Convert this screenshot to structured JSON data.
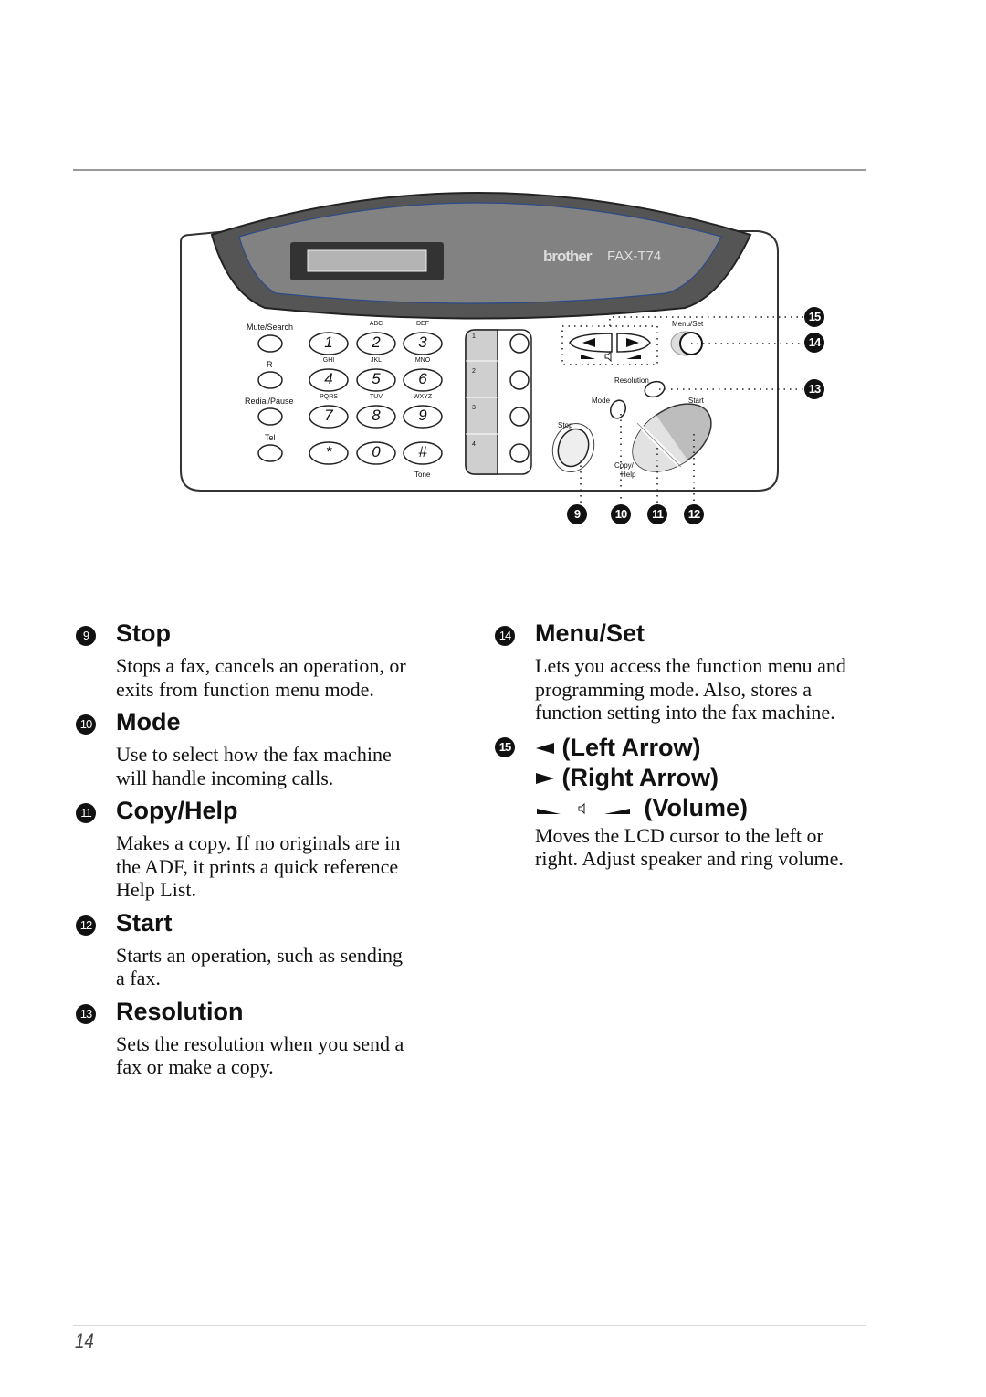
{
  "figure": {
    "brand": "brother",
    "model": "FAX-T74",
    "left_keys": [
      "Mute/Search",
      "R",
      "Redial/Pause",
      "Tel"
    ],
    "dial_keys": [
      {
        "digit": "1",
        "letters": ""
      },
      {
        "digit": "2",
        "letters": "ABC"
      },
      {
        "digit": "3",
        "letters": "DEF"
      },
      {
        "digit": "4",
        "letters": "GHI"
      },
      {
        "digit": "5",
        "letters": "JKL"
      },
      {
        "digit": "6",
        "letters": "MNO"
      },
      {
        "digit": "7",
        "letters": "PQRS"
      },
      {
        "digit": "8",
        "letters": "TUV"
      },
      {
        "digit": "9",
        "letters": "WXYZ"
      },
      {
        "digit": "*",
        "letters": ""
      },
      {
        "digit": "0",
        "letters": ""
      },
      {
        "digit": "#",
        "letters": ""
      }
    ],
    "tone_label": "Tone",
    "one_touch": [
      "1",
      "2",
      "3",
      "4"
    ],
    "labels": {
      "menu_set": "Menu/Set",
      "resolution": "Resolution",
      "mode": "Mode",
      "start": "Start",
      "stop": "Stop",
      "copy_help": "Copy/\nHelp",
      "copy": "Copy/",
      "help": "Help"
    },
    "callouts_bottom": [
      "9",
      "10",
      "11",
      "12"
    ],
    "callouts_right": [
      "15",
      "14",
      "13"
    ]
  },
  "left_column": [
    {
      "number": "9",
      "title": "Stop",
      "description": "Stops a fax, cancels an operation, or exits from function menu mode."
    },
    {
      "number": "10",
      "title": "Mode",
      "description": "Use to select how the fax machine will handle incoming calls."
    },
    {
      "number": "11",
      "title": "Copy/Help",
      "description": "Makes a copy. If no originals are in the ADF, it prints a quick reference Help List."
    },
    {
      "number": "12",
      "title": "Start",
      "description": "Starts an operation, such as sending a fax."
    },
    {
      "number": "13",
      "title": "Resolution",
      "description": "Sets the resolution when you send a fax or make a copy."
    }
  ],
  "right_column": [
    {
      "number": "14",
      "title": "Menu/Set",
      "description": "Lets you access the function menu and programming mode. Also, stores a function setting into the fax machine."
    },
    {
      "number": "15",
      "lines": [
        "(Left Arrow)",
        "(Right Arrow)",
        "(Volume)"
      ],
      "description": "Moves the LCD cursor to the left or right. Adjust speaker and ring volume."
    }
  ],
  "page_number": "14"
}
